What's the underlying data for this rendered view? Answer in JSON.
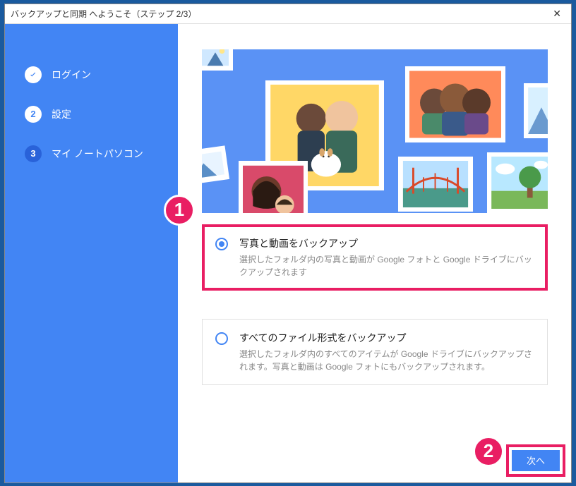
{
  "titlebar": {
    "title": "バックアップと同期 へようこそ（ステップ 2/3）"
  },
  "sidebar": {
    "steps": [
      {
        "label": "ログイン",
        "state": "done"
      },
      {
        "label": "設定",
        "state": "active",
        "num": "2"
      },
      {
        "label": "マイ ノートパソコン",
        "state": "inactive",
        "num": "3"
      }
    ]
  },
  "options": [
    {
      "title": "写真と動画をバックアップ",
      "desc": "選択したフォルダ内の写真と動画が Google フォトと Google ドライブにバックアップされます",
      "selected": true
    },
    {
      "title": "すべてのファイル形式をバックアップ",
      "desc": "選択したフォルダ内のすべてのアイテムが Google ドライブにバックアップされます。写真と動画は Google フォトにもバックアップされます。",
      "selected": false
    }
  ],
  "buttons": {
    "next": "次へ"
  },
  "annotations": {
    "one": "1",
    "two": "2"
  }
}
